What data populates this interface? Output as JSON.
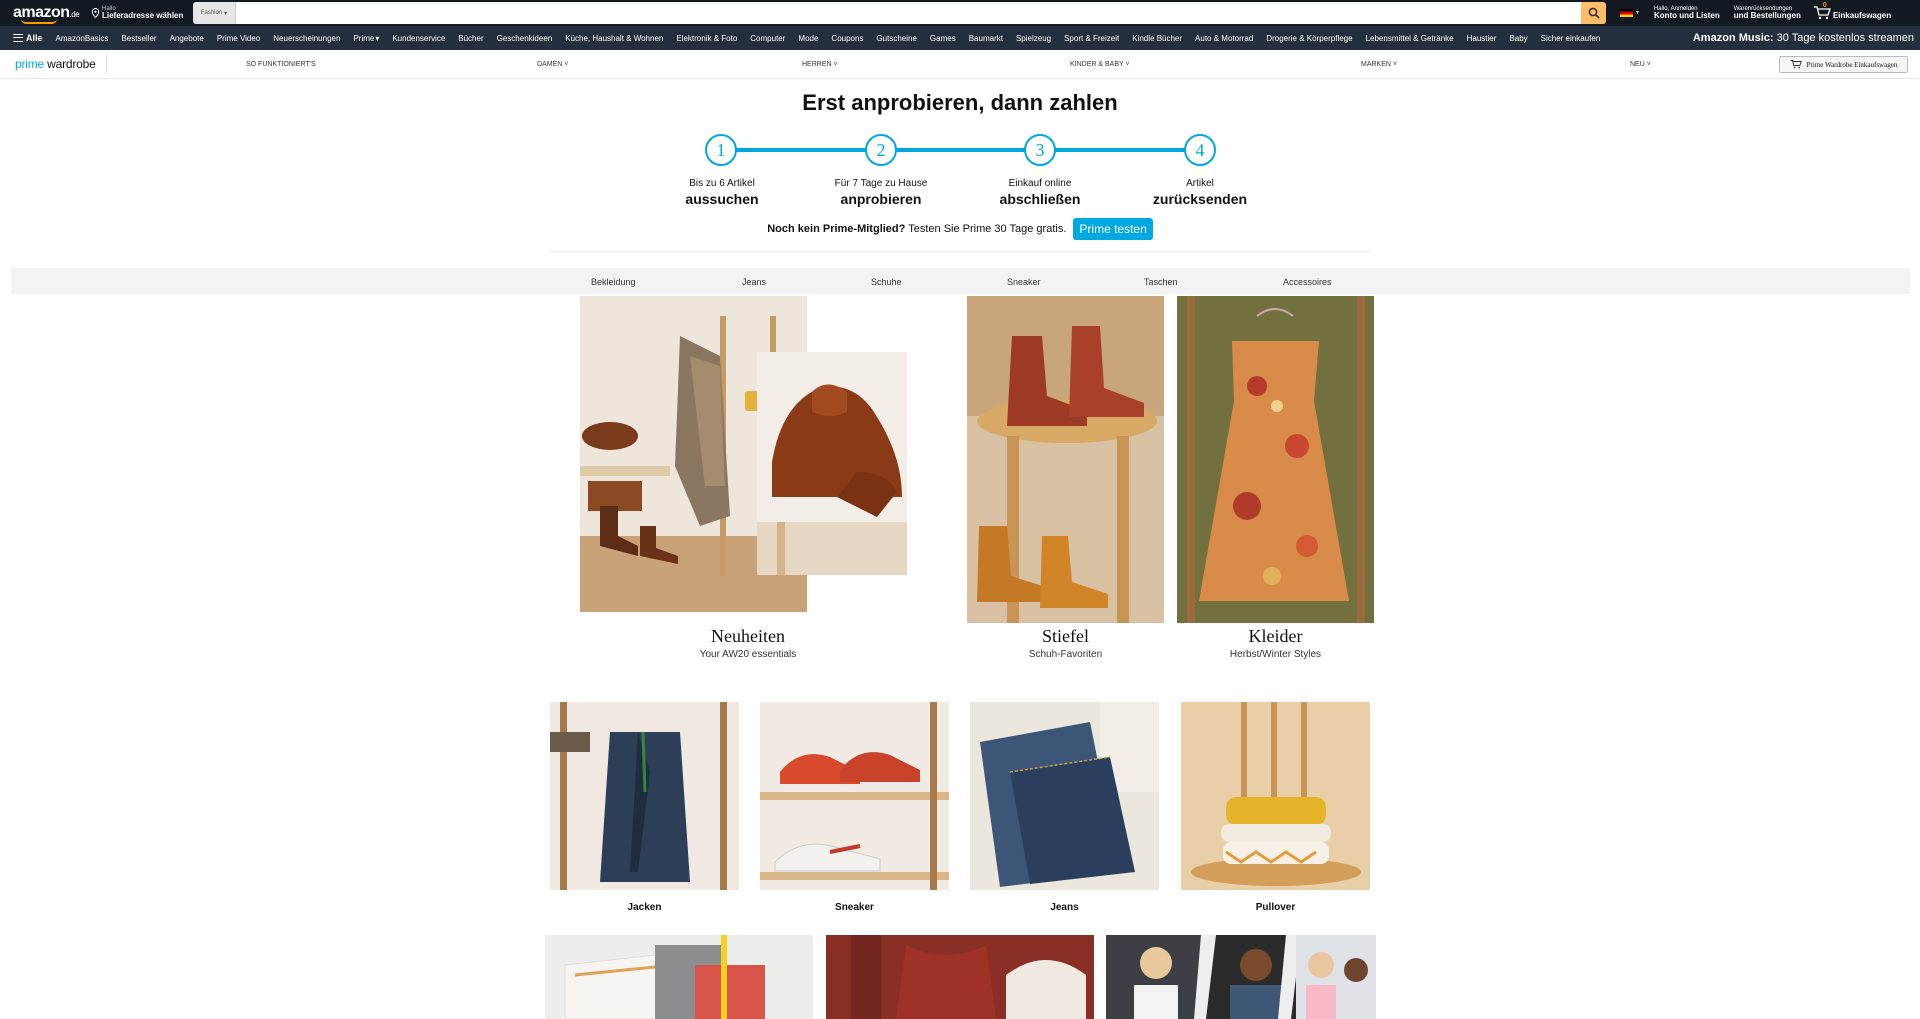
{
  "header": {
    "logo": "amazon",
    "logo_tld": ".de",
    "deliver_small": "Hallo",
    "deliver_main": "Lieferadresse wählen",
    "search_category": "Fashion",
    "search_placeholder": "",
    "account_small": "Hallo, Anmelden",
    "account_main": "Konto und Listen",
    "orders_small": "Warenrücksendungen",
    "orders_main": "und Bestellungen",
    "cart_count": "0",
    "cart_label": "Einkaufswagen",
    "accent_color": "#febd69"
  },
  "subnav": {
    "all_label": "Alle",
    "items": [
      "AmazonBasics",
      "Bestseller",
      "Angebote",
      "Prime Video",
      "Neuerscheinungen",
      "Prime",
      "Kundenservice",
      "Bücher",
      "Geschenkideen",
      "Küche, Haushalt & Wohnen",
      "Elektronik & Foto",
      "Computer",
      "Mode",
      "Coupons",
      "Gutscheine",
      "Games",
      "Baumarkt",
      "Spielzeug",
      "Sport & Freizeit",
      "Kindle Bücher",
      "Auto & Motorrad",
      "Drogerie & Körperpflege",
      "Lebensmittel & Getränke",
      "Haustier",
      "Baby",
      "Sicher einkaufen"
    ],
    "promo_bold": "Amazon Music:",
    "promo_text": " 30 Tage kostenlos streamen"
  },
  "wardrobe_bar": {
    "logo_prime": "prime",
    "logo_rest": " wardrobe",
    "menu": [
      "SO FUNKTIONIERT'S",
      "DAMEN",
      "HERREN",
      "KINDER & BABY",
      "MARKEN",
      "NEU"
    ],
    "cart_button": "Prime Wardrobe Einkaufswagen"
  },
  "how": {
    "title": "Erst anprobieren, dann zahlen",
    "steps": [
      {
        "num": "1",
        "line1": "Bis zu 6 Artikel",
        "line2": "aussuchen"
      },
      {
        "num": "2",
        "line1": "Für 7 Tage zu Hause",
        "line2": "anprobieren"
      },
      {
        "num": "3",
        "line1": "Einkauf online",
        "line2": "abschließen"
      },
      {
        "num": "4",
        "line1": "Artikel",
        "line2": "zurücksenden"
      }
    ],
    "prime_bold": "Noch kein Prime-Mitglied?",
    "prime_text": "Testen Sie Prime 30 Tage gratis.",
    "prime_button": "Prime testen",
    "brand_blue": "#00a8e1"
  },
  "category_tabs": [
    "Bekleidung",
    "Jeans",
    "Schuhe",
    "Sneaker",
    "Taschen",
    "Accessoires"
  ],
  "features": [
    {
      "title": "Neuheiten",
      "subtitle": "Your AW20 essentials"
    },
    {
      "title": "Stiefel",
      "subtitle": "Schuh-Favoriten"
    },
    {
      "title": "Kleider",
      "subtitle": "Herbst/Winter Styles"
    }
  ],
  "small_tiles": [
    "Jacken",
    "Sneaker",
    "Jeans",
    "Pullover"
  ]
}
